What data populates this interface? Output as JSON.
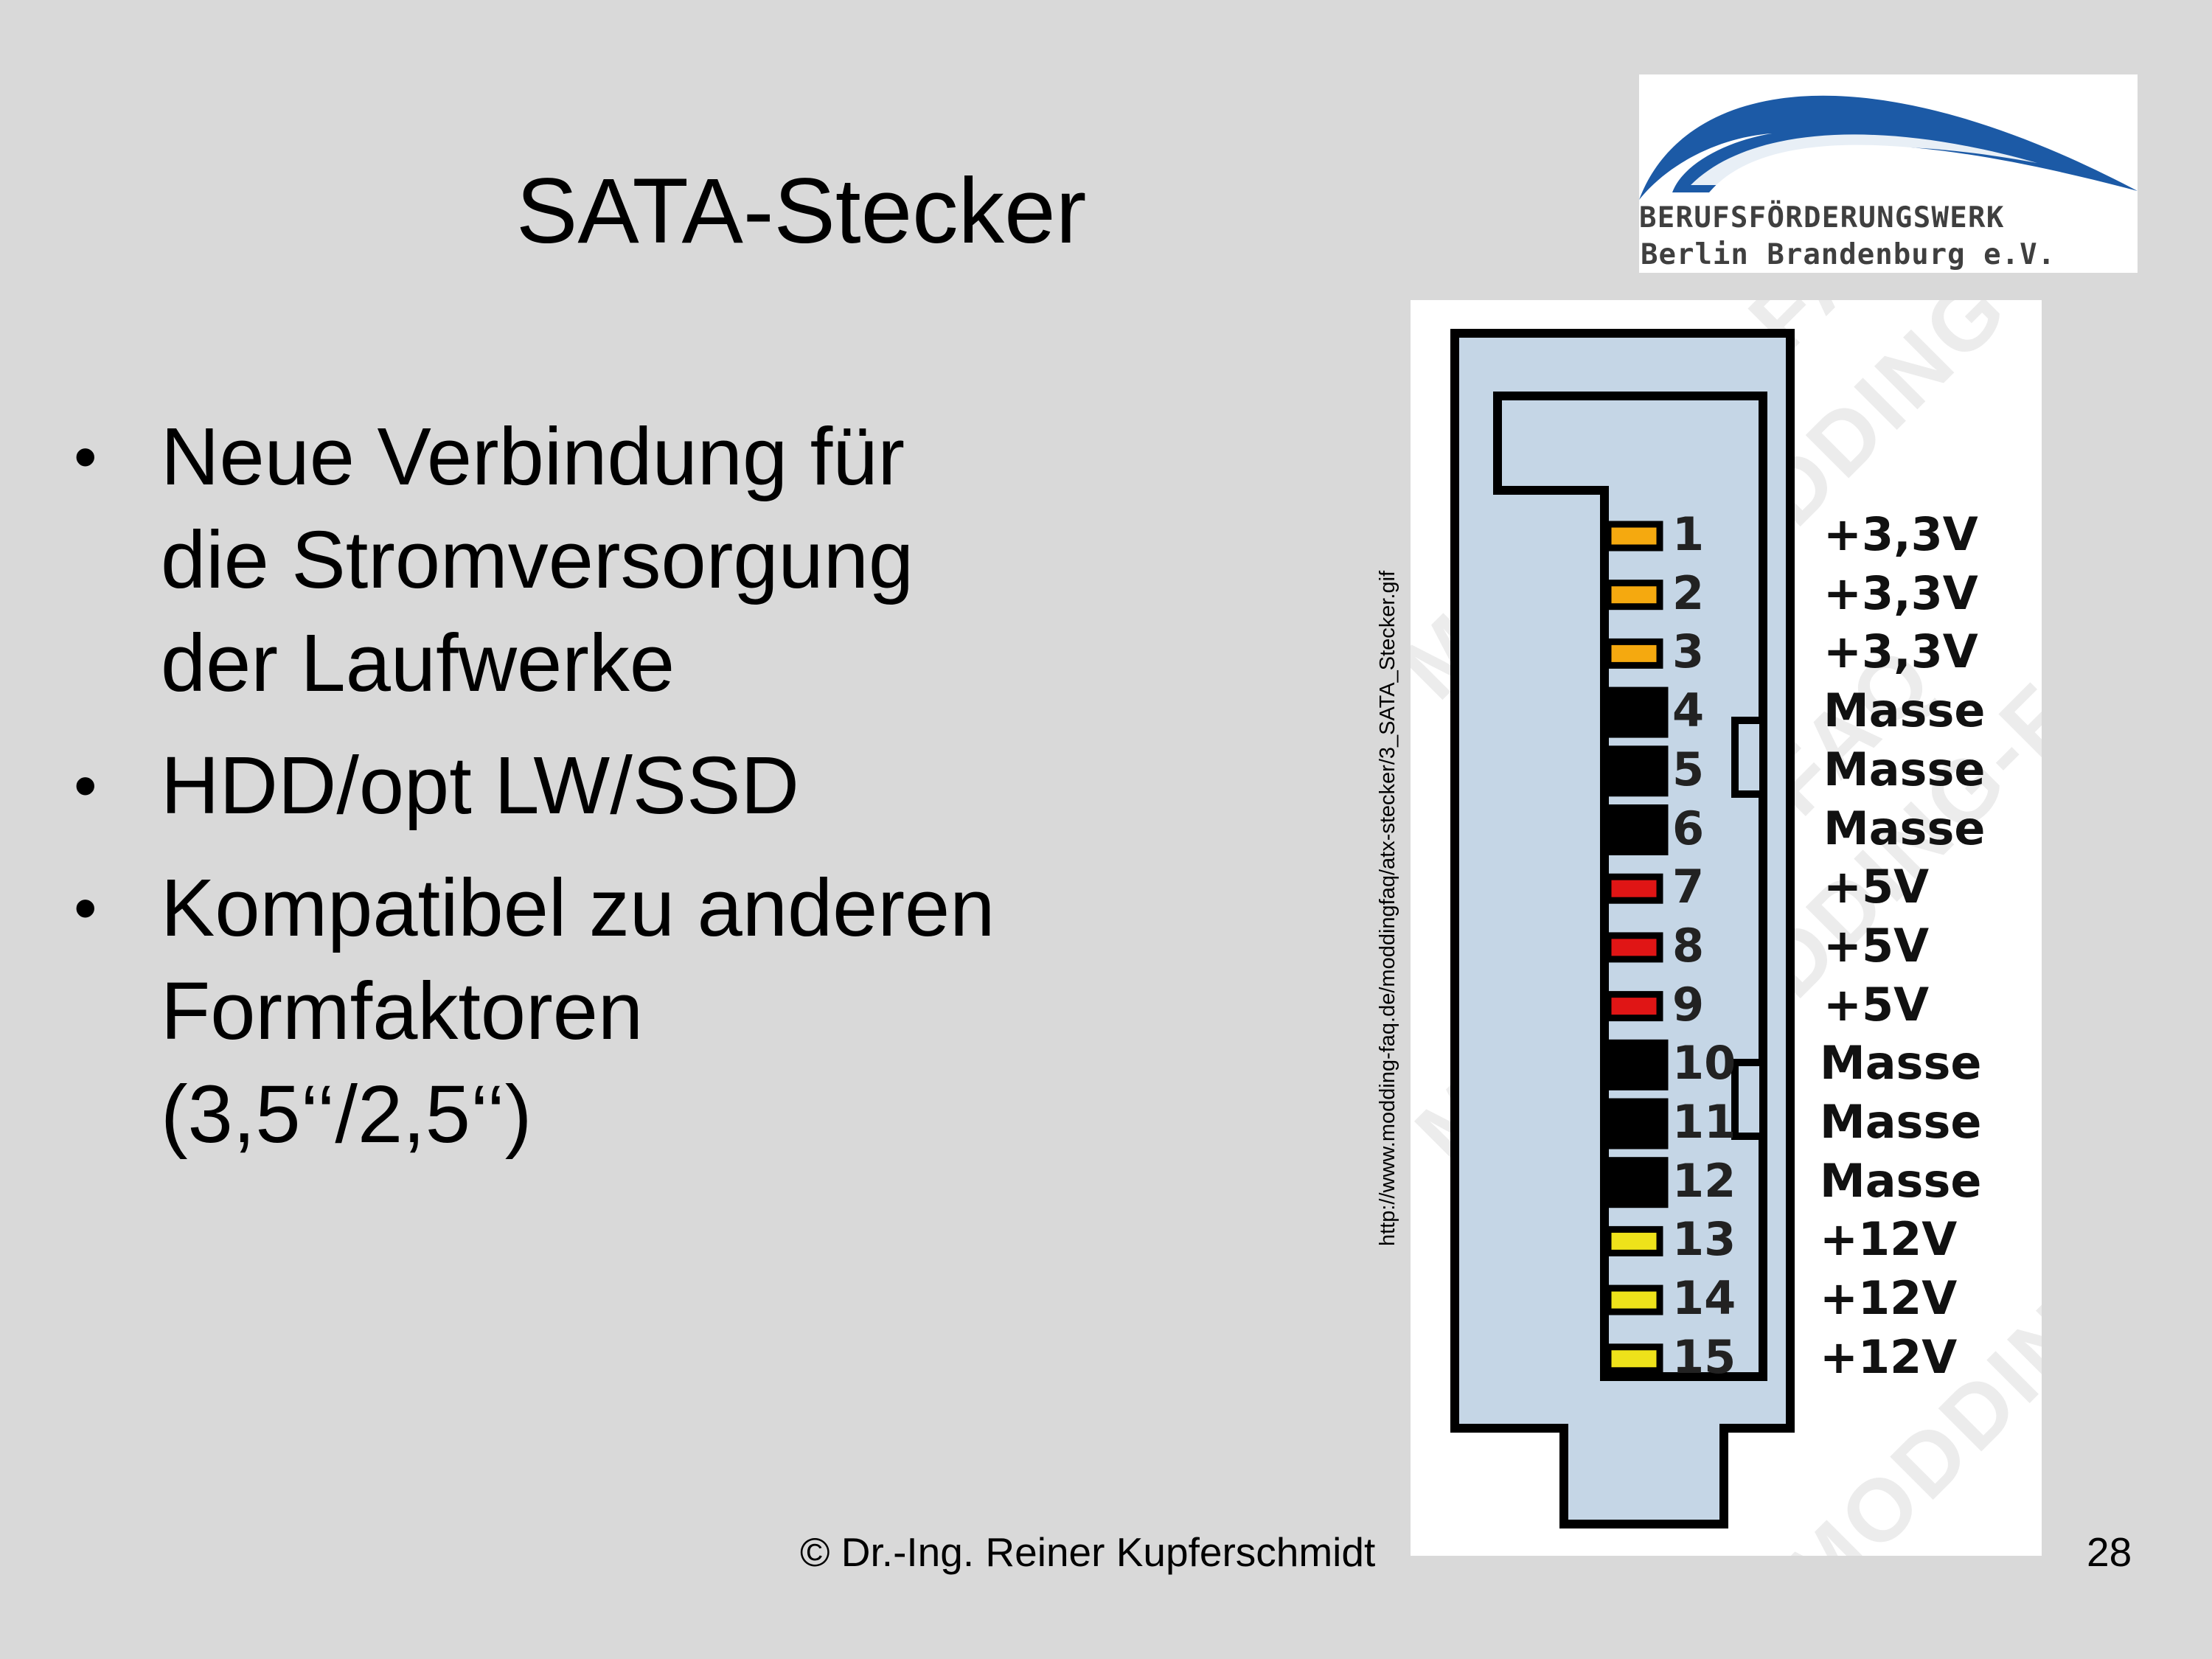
{
  "title": "SATA-Stecker",
  "logo": {
    "line1": "BERUFSFÖRDERUNGSWERK",
    "line2": "Berlin Brandenburg e.V.",
    "arc_color": "#1c5aa6"
  },
  "bullets": [
    {
      "lines": [
        "Neue Verbindung für",
        "die Stromversorgung",
        "der Laufwerke"
      ]
    },
    {
      "lines": [
        "HDD/opt LW/SSD"
      ]
    },
    {
      "lines": [
        "Kompatibel zu anderen",
        "Formfaktoren",
        "(3,5‘‘/2,5‘‘)"
      ]
    }
  ],
  "bullet_glyph": "•",
  "source_url": "http://www.modding-faq.de/moddingfaq/atx-stecker/3_SATA_Stecker.gif",
  "connector": {
    "body_color": "#c5d6e6",
    "watermark": "MODDING-FAQ",
    "pins": [
      {
        "num": "1",
        "label": "+3,3V",
        "color": "#f5a90f"
      },
      {
        "num": "2",
        "label": "+3,3V",
        "color": "#f5a90f"
      },
      {
        "num": "3",
        "label": "+3,3V",
        "color": "#f5a90f"
      },
      {
        "num": "4",
        "label": "Masse",
        "color": "#000000"
      },
      {
        "num": "5",
        "label": "Masse",
        "color": "#000000"
      },
      {
        "num": "6",
        "label": "Masse",
        "color": "#000000"
      },
      {
        "num": "7",
        "label": "+5V",
        "color": "#e01515"
      },
      {
        "num": "8",
        "label": "+5V",
        "color": "#e01515"
      },
      {
        "num": "9",
        "label": "+5V",
        "color": "#e01515"
      },
      {
        "num": "10",
        "label": "Masse",
        "color": "#000000"
      },
      {
        "num": "11",
        "label": "Masse",
        "color": "#000000"
      },
      {
        "num": "12",
        "label": "Masse",
        "color": "#000000"
      },
      {
        "num": "13",
        "label": "+12V",
        "color": "#eee21a"
      },
      {
        "num": "14",
        "label": "+12V",
        "color": "#eee21a"
      },
      {
        "num": "15",
        "label": "+12V",
        "color": "#eee21a"
      }
    ]
  },
  "footer": "© Dr.-Ing. Reiner Kupferschmidt",
  "page_number": "28"
}
